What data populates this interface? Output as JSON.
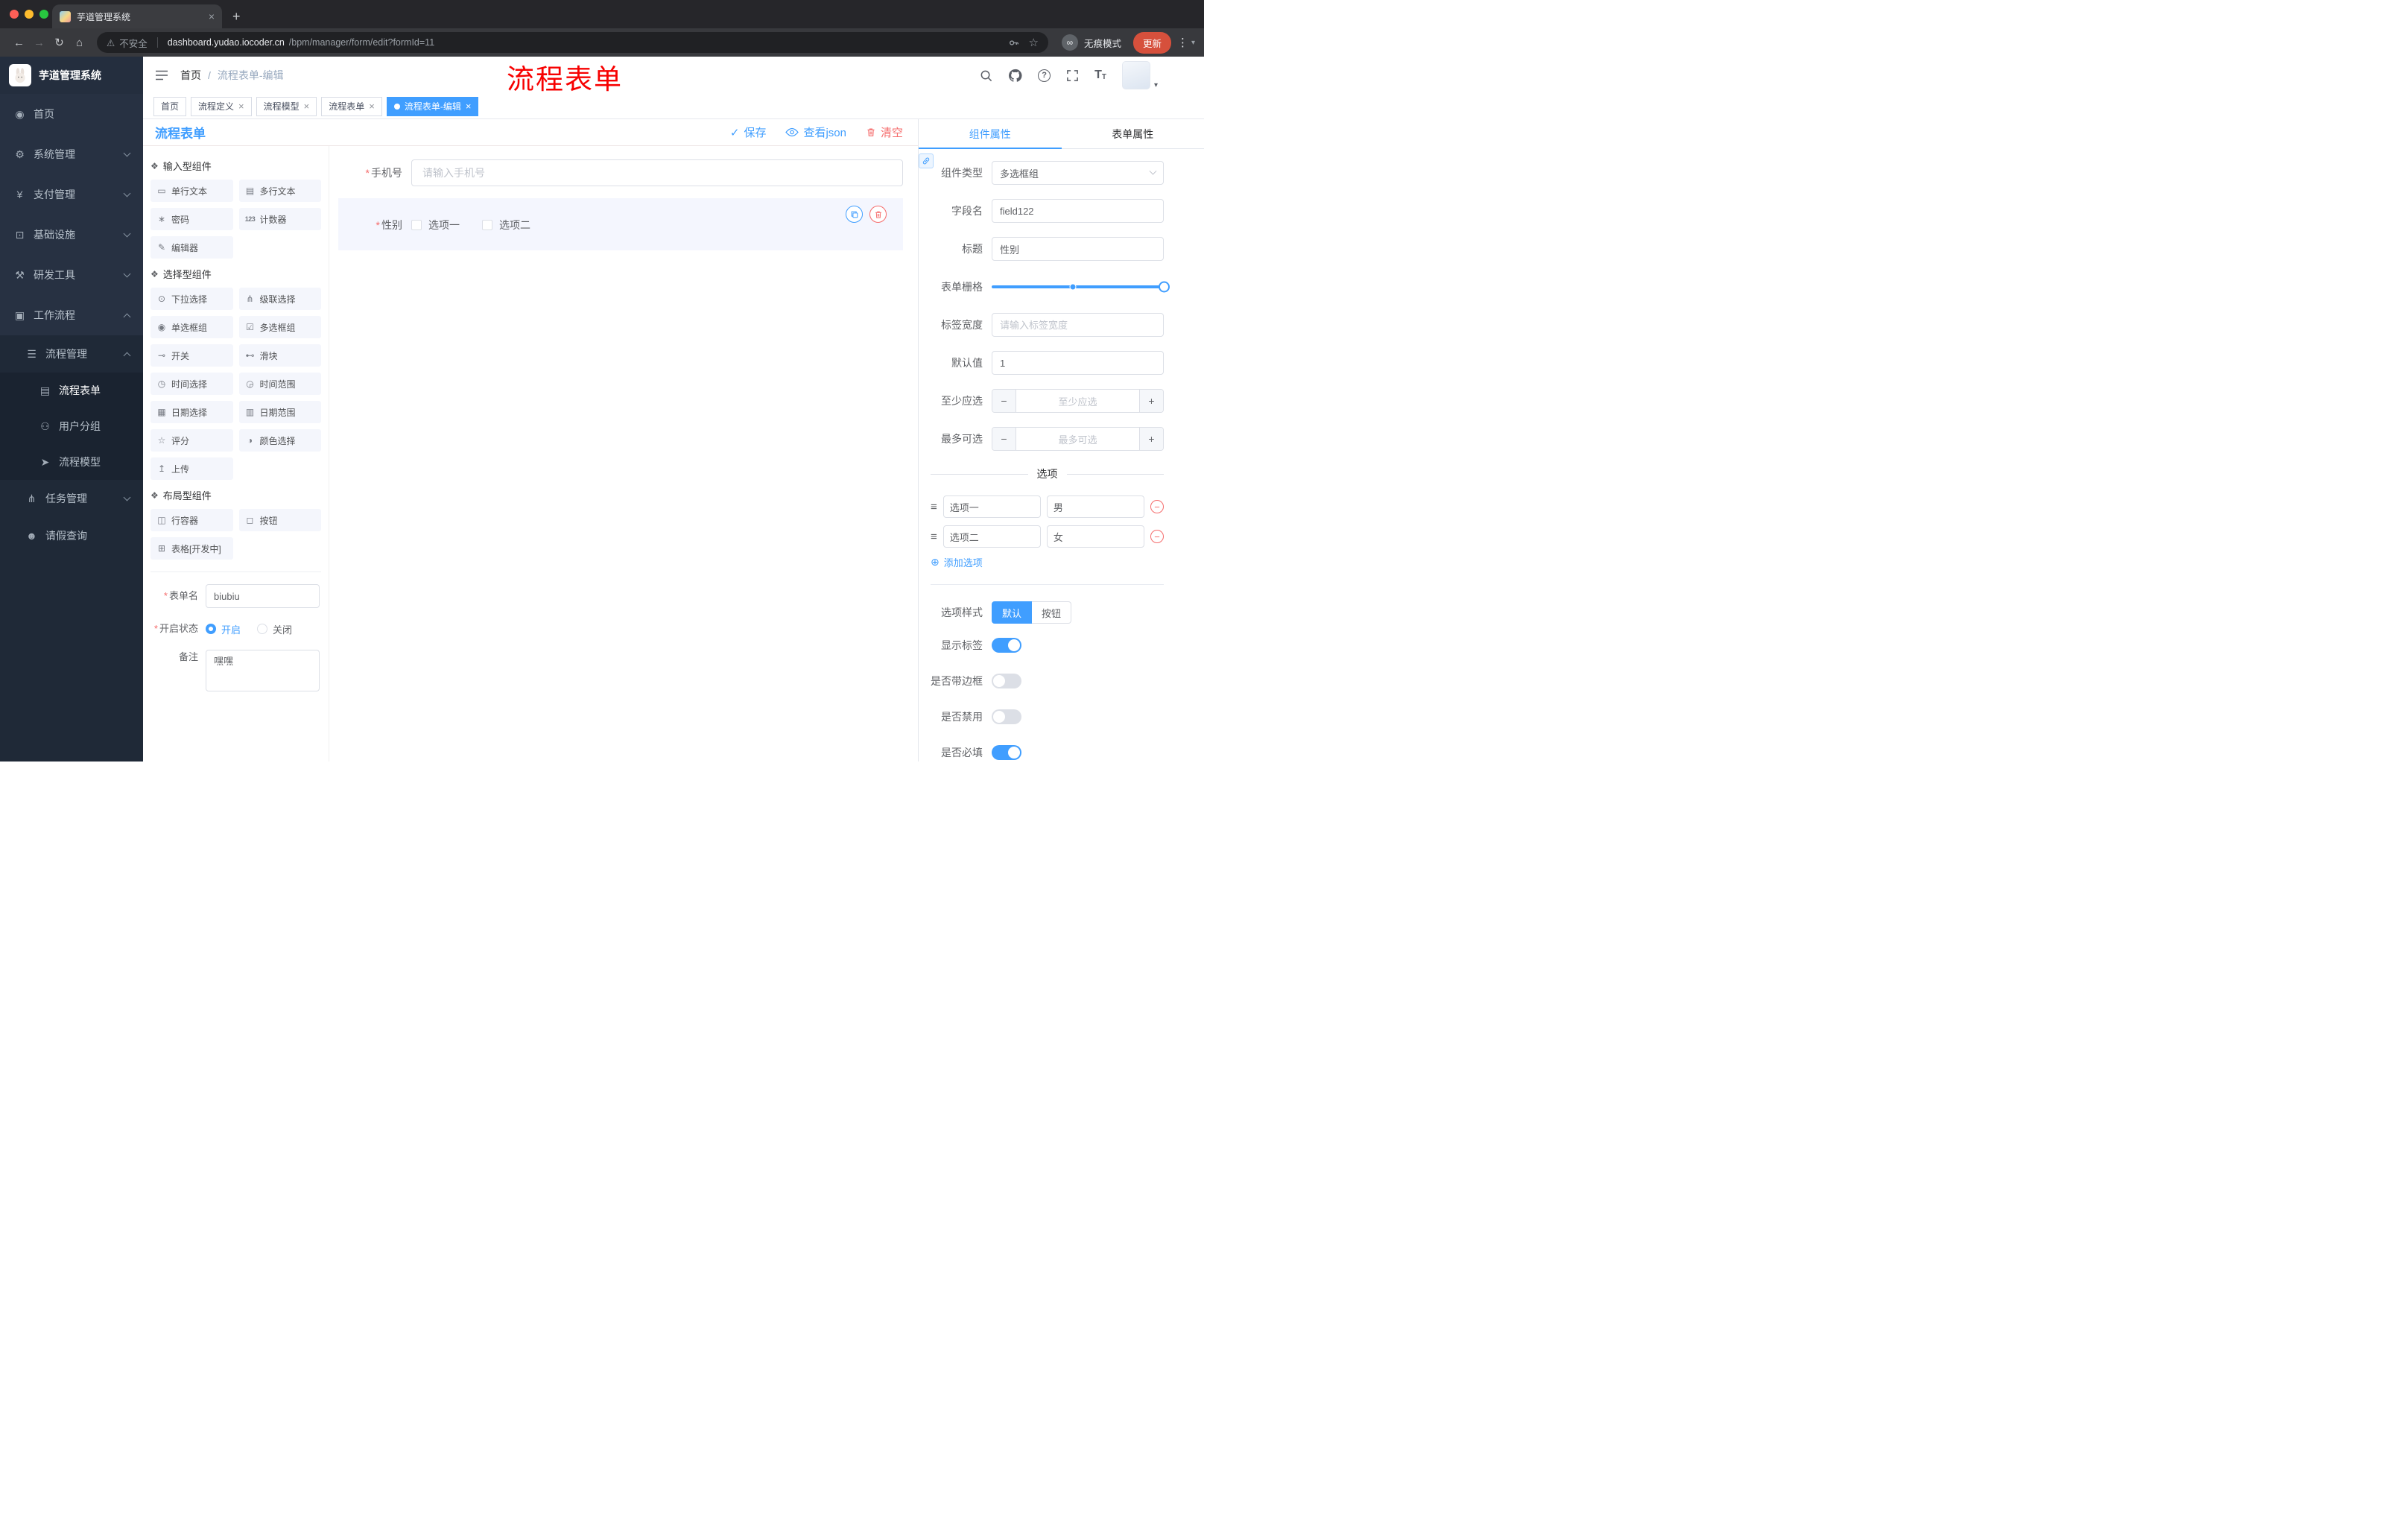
{
  "browser": {
    "tab_title": "芋道管理系统",
    "security_label": "不安全",
    "url_host": "dashboard.yudao.iocoder.cn",
    "url_path": "/bpm/manager/form/edit?formId=11",
    "incognito_label": "无痕模式",
    "update_label": "更新"
  },
  "annotation": {
    "text": "流程表单"
  },
  "colors": {
    "accent": "#409EFF",
    "danger": "#F56C6C",
    "annotation": "#F70000",
    "sidebar_bg": "#273142"
  },
  "sidebar": {
    "brand": "芋道管理系统",
    "items": [
      {
        "label": "首页"
      },
      {
        "label": "系统管理"
      },
      {
        "label": "支付管理"
      },
      {
        "label": "基础设施"
      },
      {
        "label": "研发工具"
      },
      {
        "label": "工作流程"
      },
      {
        "label": "流程管理"
      },
      {
        "label": "流程表单"
      },
      {
        "label": "用户分组"
      },
      {
        "label": "流程模型"
      },
      {
        "label": "任务管理"
      },
      {
        "label": "请假查询"
      }
    ]
  },
  "header": {
    "breadcrumb_home": "首页",
    "breadcrumb_sep": "/",
    "breadcrumb_current": "流程表单-编辑"
  },
  "tags": [
    {
      "label": "首页"
    },
    {
      "label": "流程定义"
    },
    {
      "label": "流程模型"
    },
    {
      "label": "流程表单"
    },
    {
      "label": "流程表单-编辑"
    }
  ],
  "designer": {
    "title": "流程表单",
    "save": "保存",
    "view_json": "查看json",
    "clear": "清空"
  },
  "components": {
    "groups": [
      {
        "title": "输入型组件",
        "items": [
          {
            "label": "单行文本"
          },
          {
            "label": "多行文本"
          },
          {
            "label": "密码"
          },
          {
            "label": "计数器"
          },
          {
            "label": "编辑器"
          }
        ]
      },
      {
        "title": "选择型组件",
        "items": [
          {
            "label": "下拉选择"
          },
          {
            "label": "级联选择"
          },
          {
            "label": "单选框组"
          },
          {
            "label": "多选框组"
          },
          {
            "label": "开关"
          },
          {
            "label": "滑块"
          },
          {
            "label": "时间选择"
          },
          {
            "label": "时间范围"
          },
          {
            "label": "日期选择"
          },
          {
            "label": "日期范围"
          },
          {
            "label": "评分"
          },
          {
            "label": "颜色选择"
          },
          {
            "label": "上传"
          }
        ]
      },
      {
        "title": "布局型组件",
        "items": [
          {
            "label": "行容器"
          },
          {
            "label": "按钮"
          },
          {
            "label": "表格[开发中]"
          }
        ]
      }
    ]
  },
  "meta": {
    "form_name_label": "表单名",
    "form_name_value": "biubiu",
    "status_label": "开启状态",
    "status_on": "开启",
    "status_off": "关闭",
    "remark_label": "备注",
    "remark_value": "嘿嘿"
  },
  "canvas": {
    "phone_label": "手机号",
    "phone_placeholder": "请输入手机号",
    "gender_label": "性别",
    "gender_options": [
      {
        "label": "选项一"
      },
      {
        "label": "选项二"
      }
    ]
  },
  "props": {
    "tab_component": "组件属性",
    "tab_form": "表单属性",
    "type_label": "组件类型",
    "type_value": "多选框组",
    "field_label": "字段名",
    "field_value": "field122",
    "title_label": "标题",
    "title_value": "性别",
    "grid_label": "表单栅格",
    "label_width_label": "标签宽度",
    "label_width_placeholder": "请输入标签宽度",
    "default_label": "默认值",
    "default_value": "1",
    "min_label": "至少应选",
    "min_placeholder": "至少应选",
    "max_label": "最多可选",
    "max_placeholder": "最多可选",
    "options_title": "选项",
    "options": [
      {
        "label": "选项一",
        "value": "男"
      },
      {
        "label": "选项二",
        "value": "女"
      }
    ],
    "add_option": "添加选项",
    "style_label": "选项样式",
    "style_default": "默认",
    "style_button": "按钮",
    "switch_show_label": "显示标签",
    "switch_border": "是否带边框",
    "switch_disabled": "是否禁用",
    "switch_required": "是否必填"
  },
  "icons": {
    "close": "×",
    "plus": "+",
    "minus": "−",
    "required": "*",
    "back": "←",
    "forward": "→",
    "reload": "↻",
    "home": "⌂",
    "warning": "⚠",
    "star": "☆",
    "infinity": "∞",
    "dots": "⋮",
    "caret": "▾",
    "question": "?",
    "check": "✓",
    "font_big": "T",
    "font_small": "T",
    "dashboard": "◉",
    "system": "⚙",
    "payment": "¥",
    "infra": "⊡",
    "devtools": "⚒",
    "workflow": "▣",
    "process": "☰",
    "form_doc": "▤",
    "users": "⚇",
    "model": "➤",
    "tasks": "⋔",
    "person": "☻",
    "group": "❖",
    "chip_single": "▭",
    "chip_multi": "▤",
    "chip_pwd": "∗",
    "chip_counter": "123",
    "chip_editor": "✎",
    "chip_select": "⊙",
    "chip_cascade": "⋔",
    "chip_radio": "◉",
    "chip_checkbox": "☑",
    "chip_switch": "⊸",
    "chip_slider": "⊷",
    "chip_time": "◷",
    "chip_timerange": "◶",
    "chip_date": "▦",
    "chip_daterange": "▥",
    "chip_rate": "☆",
    "chip_color": "◑",
    "chip_upload": "↥",
    "chip_row": "◫",
    "chip_button": "◻",
    "chip_table": "⊞",
    "add_circle": "⊕",
    "option_handle": "≡"
  }
}
